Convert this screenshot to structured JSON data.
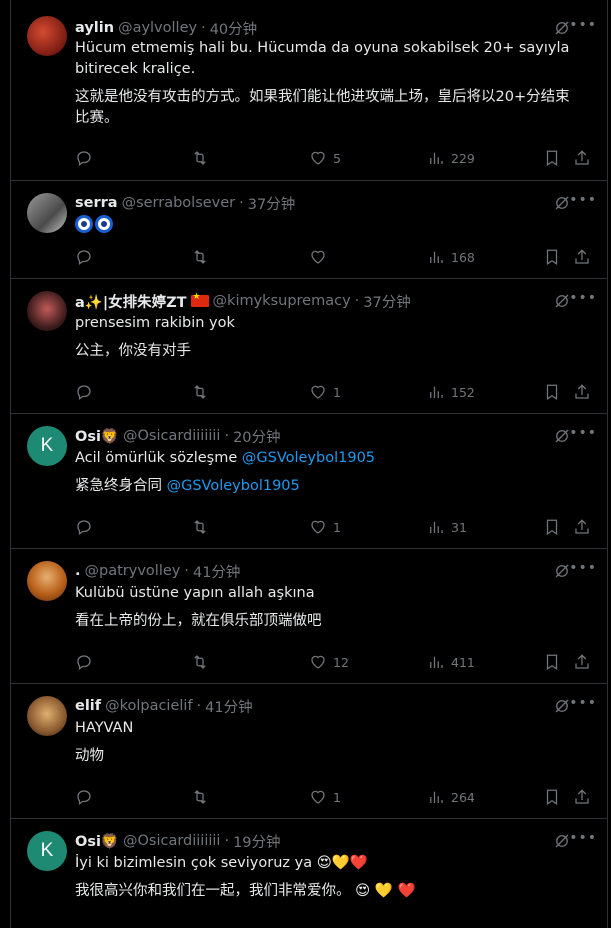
{
  "tweets": [
    {
      "avatar": "photo-red",
      "name": "aylin",
      "handle": "@aylvolley",
      "dot": "·",
      "time": "40分钟",
      "lines": [
        "Hücum etmemiş hali bu. Hücumda da oyuna sokabilsek 20+ sayıyla",
        "bitirecek kraliçe."
      ],
      "zh_lines": [
        "这就是他没有攻击的方式。如果我们能让他进攻端上场，皇后将以20+分结束",
        "比赛。"
      ],
      "likes": "5",
      "views": "229"
    },
    {
      "avatar": "photo-gray",
      "name": "serra",
      "handle": "@serrabolsever",
      "dot": "·",
      "time": "37分钟",
      "emoji_text": "nazar-eye-icon nazar-eye-icon",
      "likes": "",
      "views": "168"
    },
    {
      "avatar": "photo-dark",
      "name": "a✨|女排朱婷ZT",
      "handle": "@kimyksupremacy",
      "dot": "·",
      "time": "37分钟",
      "lines": [
        "prensesim rakibin yok"
      ],
      "zh_lines": [
        "公主，你没有对手"
      ],
      "likes": "1",
      "views": "152"
    },
    {
      "avatar_letter": "K",
      "name": "Osi🦁",
      "handle": "@Osicardiiiiiii",
      "dot": "·",
      "time": "20分钟",
      "line_prefix": "Acil ömürlük sözleşme ",
      "line_mention": "@GSVoleybol1905",
      "zh_prefix": "紧急终身合同 ",
      "zh_mention": "@GSVoleybol1905",
      "likes": "1",
      "views": "31"
    },
    {
      "avatar": "photo-orange",
      "name": ".",
      "handle": "@patryvolley",
      "dot": "·",
      "time": "41分钟",
      "lines": [
        "Kulübü üstüne yapın allah aşkına"
      ],
      "zh_lines": [
        "看在上帝的份上，就在俱乐部顶端做吧"
      ],
      "likes": "12",
      "views": "411"
    },
    {
      "avatar": "photo-blonde",
      "name": "elif",
      "handle": "@kolpacielif",
      "dot": "·",
      "time": "41分钟",
      "lines": [
        "HAYVAN"
      ],
      "zh_lines": [
        "动物"
      ],
      "likes": "1",
      "views": "264"
    },
    {
      "avatar_letter": "K",
      "name": "Osi🦁",
      "handle": "@Osicardiiiiiii",
      "dot": "·",
      "time": "19分钟",
      "lines": [
        "İyi ki bizimlesin çok seviyoruz ya 😍💛❤️"
      ],
      "zh_lines": [
        "我很高兴你和我们在一起，我们非常爱你。 😍 💛 ❤️"
      ]
    }
  ],
  "icons": {
    "reply": "reply-icon",
    "retweet": "retweet-icon",
    "like": "heart-icon",
    "views": "views-icon",
    "bookmark": "bookmark-icon",
    "share": "share-icon",
    "grok": "grok-icon",
    "more": "more-icon"
  },
  "colors": {
    "background": "#000000",
    "text": "#e7e9ea",
    "muted": "#71767b",
    "link": "#1d9bf0",
    "divider": "#2f3336",
    "avatar_letter_bg": "#1e8a74"
  }
}
